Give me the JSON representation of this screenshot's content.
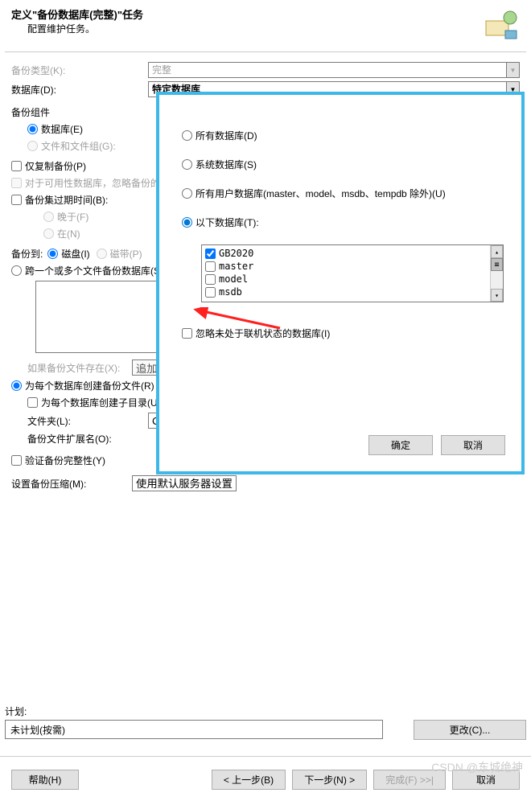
{
  "header": {
    "title": "定义\"备份数据库(完整)\"任务",
    "subtitle": "配置维护任务。"
  },
  "form": {
    "backup_type_label": "备份类型(K):",
    "backup_type_value": "完整",
    "database_label": "数据库(D):",
    "database_value": "特定数据库",
    "component_label": "备份组件",
    "component_db": "数据库(E)",
    "component_fg": "文件和文件组(G):",
    "copy_only": "仅复制备份(P)",
    "avail_ignore": "对于可用性数据库，忽略备份的副本优先级和在主副本上备份设置",
    "expire_label": "备份集过期时间(B):",
    "expire_after": "晚于(F)",
    "expire_on": "在(N)",
    "backup_to_label": "备份到:",
    "backup_to_disk": "磁盘(I)",
    "backup_to_tape": "磁带(P)",
    "span_files": "跨一个或多个文件备份数据库(S):",
    "if_exists_label": "如果备份文件存在(X):",
    "if_exists_value": "追加",
    "per_db_file": "为每个数据库创建备份文件(R)",
    "per_db_subdir": "为每个数据库创建子目录(U)",
    "folder_label": "文件夹(L):",
    "folder_value": "C:\\Program Files\\...",
    "ext_label": "备份文件扩展名(O):",
    "verify": "验证备份完整性(Y)",
    "compression_label": "设置备份压缩(M):",
    "compression_value": "使用默认服务器设置"
  },
  "modal": {
    "opt_all": "所有数据库(D)",
    "opt_system": "系统数据库(S)",
    "opt_user": "所有用户数据库(master、model、msdb、tempdb 除外)(U)",
    "opt_these": "以下数据库(T):",
    "databases": [
      "GB2020",
      "master",
      "model",
      "msdb"
    ],
    "ignore_offline": "忽略未处于联机状态的数据库(I)",
    "ok": "确定",
    "cancel": "取消"
  },
  "plan": {
    "label": "计划:",
    "value": "未计划(按需)",
    "change": "更改(C)..."
  },
  "footer": {
    "help": "帮助(H)",
    "prev": "< 上一步(B)",
    "next": "下一步(N) >",
    "finish": "完成(F) >>|",
    "cancel": "取消"
  },
  "watermark": "CSDN @东城绝神"
}
